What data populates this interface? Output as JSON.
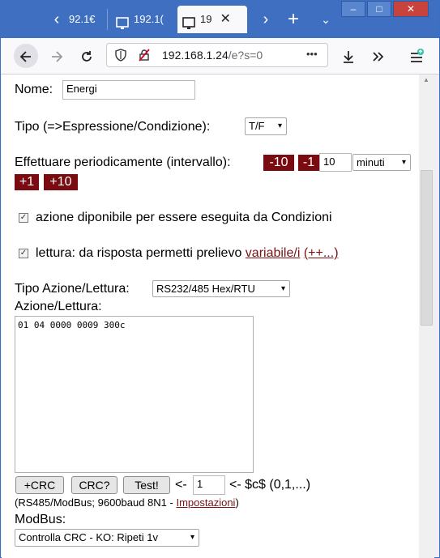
{
  "browser": {
    "tabs": [
      {
        "label": "92.1€"
      },
      {
        "label": "192.1("
      },
      {
        "label": "19"
      }
    ],
    "tab_close_glyph": "✕",
    "new_tab_glyph": "+",
    "url_host": "192.168.1.24",
    "url_path": "/e?s=0",
    "page_actions_glyph": "•••"
  },
  "form": {
    "nome_label": "Nome:",
    "nome_value": "Energi",
    "tipo_label": "Tipo (=>Espressione/Condizione):",
    "tipo_value": "T/F",
    "periodic_label": "Effettuare periodicamente (intervallo):",
    "minus10": "-10",
    "minus1": "-1",
    "interval_value": "10",
    "unit_value": "minuti",
    "plus1": "+1",
    "plus10": "+10",
    "check1_label": "azione diponibile per essere eseguita da Condizioni",
    "check2_label": "lettura: da risposta permetti prelievo",
    "check2_link1": "variabile/i",
    "check2_link2": "(++...)",
    "tipo_azione_label": "Tipo Azione/Lettura:",
    "tipo_azione_value": "RS232/485 Hex/RTU",
    "azione_label": "Azione/Lettura:",
    "azione_text": "01 04 0000 0009 300c",
    "crc_button": "+CRC",
    "crc_check_button": "CRC?",
    "test_button": "Test!",
    "arrow_left": "<-",
    "c_value": "1",
    "c_label": "<- $c$ (0,1,...)",
    "info_prefix": "(RS485/ModBus; 9600baud 8N1 - ",
    "info_link": "Impostazioni",
    "info_suffix": ")",
    "modbus_label": "ModBus:",
    "modbus_value": "Controlla CRC - KO: Ripeti 1v"
  }
}
